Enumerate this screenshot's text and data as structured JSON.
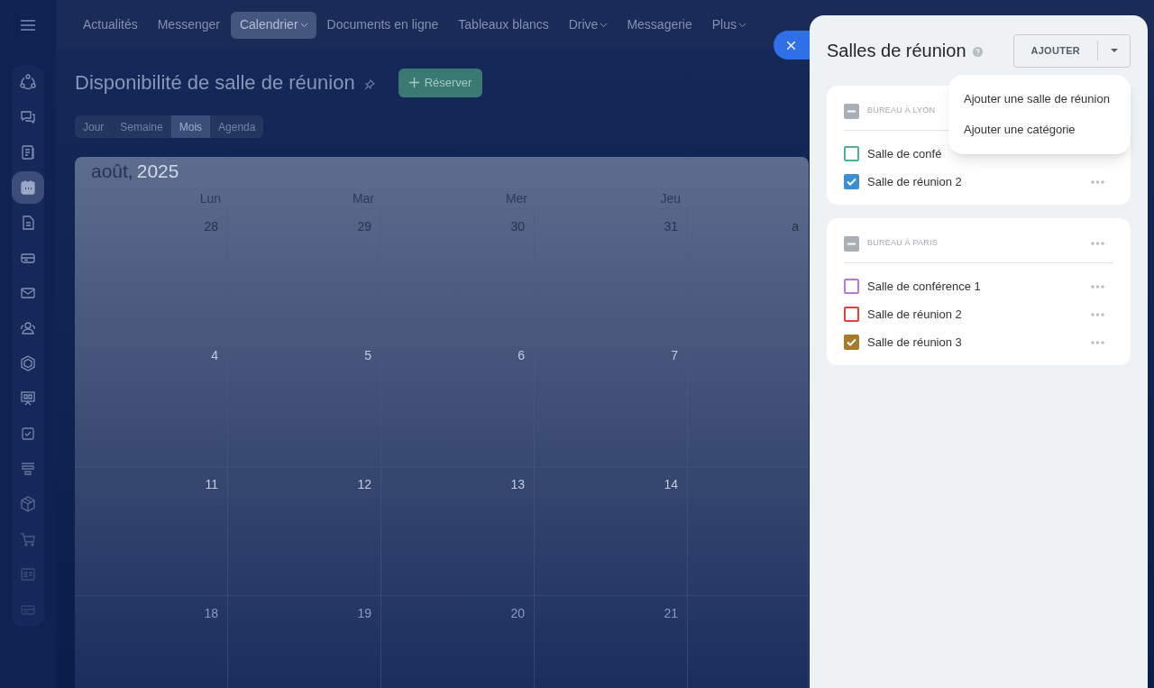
{
  "sidebar": {
    "items": [
      {
        "kind": "stream",
        "selected": false
      },
      {
        "kind": "chat",
        "selected": false
      },
      {
        "kind": "news",
        "selected": false
      },
      {
        "kind": "calendar",
        "selected": true
      },
      {
        "kind": "document",
        "selected": false
      },
      {
        "kind": "drive",
        "selected": false
      },
      {
        "kind": "mail",
        "selected": false
      },
      {
        "kind": "people",
        "selected": false
      },
      {
        "kind": "hexagon",
        "selected": false
      },
      {
        "kind": "board",
        "selected": false
      },
      {
        "kind": "task",
        "selected": false
      },
      {
        "kind": "funnel",
        "selected": false
      },
      {
        "kind": "box",
        "selected": false
      },
      {
        "kind": "cart",
        "selected": false
      },
      {
        "kind": "card",
        "selected": false
      },
      {
        "kind": "drive",
        "selected": false
      }
    ]
  },
  "top_nav": [
    {
      "label": "Actualités",
      "selected": false,
      "dropdown": false
    },
    {
      "label": "Messenger",
      "selected": false,
      "dropdown": false
    },
    {
      "label": "Calendrier",
      "selected": true,
      "dropdown": true
    },
    {
      "label": "Documents en ligne",
      "selected": false,
      "dropdown": false
    },
    {
      "label": "Tableaux blancs",
      "selected": false,
      "dropdown": false
    },
    {
      "label": "Drive",
      "selected": false,
      "dropdown": true
    },
    {
      "label": "Messagerie",
      "selected": false,
      "dropdown": false
    },
    {
      "label": "Plus",
      "selected": false,
      "dropdown": true
    }
  ],
  "page": {
    "title": "Disponibilité de salle de réunion",
    "reserve_button": "Réserver",
    "views": [
      {
        "label": "Jour",
        "selected": false
      },
      {
        "label": "Semaine",
        "selected": false
      },
      {
        "label": "Mois",
        "selected": true
      },
      {
        "label": "Agenda",
        "selected": false
      }
    ]
  },
  "calendar": {
    "month": "août,",
    "year": "2025",
    "weekdays": [
      "Lun",
      "Mar",
      "Mer",
      "Jeu"
    ],
    "weeks": [
      [
        "28",
        "29",
        "30",
        "31",
        "a"
      ],
      [
        "4",
        "5",
        "6",
        "7"
      ],
      [
        "11",
        "12",
        "13",
        "14"
      ],
      [
        "18",
        "19",
        "20",
        "21"
      ]
    ]
  },
  "panel": {
    "title": "Salles de réunion",
    "add_button": "AJOUTER",
    "menu": [
      "Ajouter une salle de réunion",
      "Ajouter une catégorie"
    ],
    "sections": [
      {
        "title": "BUREAU À LYON",
        "indeterminate": true,
        "rooms": [
          {
            "name": "Salle de confé",
            "color": "#4fb38a",
            "checked": false,
            "menu": false
          },
          {
            "name": "Salle de réunion 2",
            "color": "#3b8fd6",
            "checked": true,
            "menu": true
          }
        ]
      },
      {
        "title": "BUREAU À PARIS",
        "indeterminate": true,
        "rooms": [
          {
            "name": "Salle de conférence 1",
            "color": "#b77bd6",
            "checked": false,
            "menu": true
          },
          {
            "name": "Salle de réunion 2",
            "color": "#e0413b",
            "checked": false,
            "menu": true
          },
          {
            "name": "Salle de réunion 3",
            "color": "#a87a2c",
            "checked": true,
            "menu": true
          }
        ]
      }
    ]
  }
}
